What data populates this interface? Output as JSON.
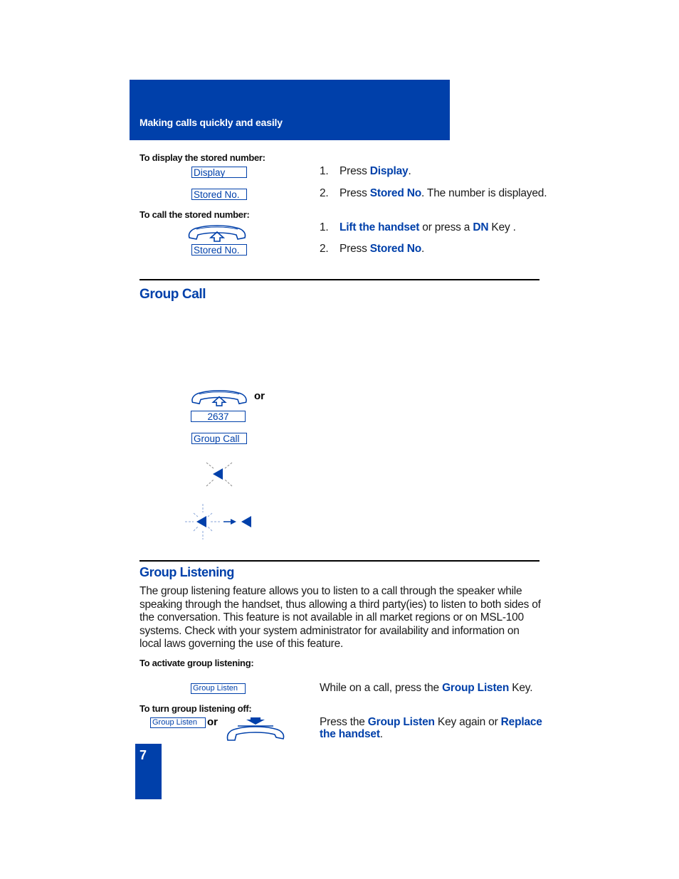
{
  "header": {
    "title": "Making calls quickly and easily",
    "color": "#0040aa"
  },
  "display_stored": {
    "subheading": "To display the stored number:",
    "keys": [
      "Display",
      "Stored No."
    ],
    "steps": [
      {
        "num": "1.",
        "pre": "Press ",
        "key": "Display",
        "post": "."
      },
      {
        "num": "2.",
        "pre": "Press ",
        "key": "Stored No",
        "post": ". The number is displayed."
      }
    ]
  },
  "call_stored": {
    "subheading": "To call the stored number:",
    "icon": "handset-lift-icon",
    "key": "Stored No.",
    "steps": [
      {
        "num": "1.",
        "key1": "Lift the handset",
        "mid": " or press a ",
        "key2": "DN",
        "post": " Key ."
      },
      {
        "num": "2.",
        "pre": "Press ",
        "key": "Stored No",
        "post": "."
      }
    ]
  },
  "group_call": {
    "title": "Group Call",
    "icon": "handset-lift-icon",
    "or_label": "or",
    "code": "2637",
    "key": "Group Call",
    "indicator_icons": [
      "indicator-flash-icon",
      "indicator-flash-to-steady-icon"
    ]
  },
  "group_listening": {
    "title": "Group Listening",
    "description": "The group listening feature allows you to listen to a call through the speaker while speaking through the handset, thus allowing a third party(ies) to listen to both sides of the conversation. This feature is not available in all market regions or on MSL-100 systems. Check with your system administrator for availability and information on local laws governing the use of this feature.",
    "activate": {
      "subheading": "To activate group listening:",
      "key": "Group Listen",
      "pre": "While on a call, press the ",
      "key_text": "Group Listen",
      "post": " Key."
    },
    "deactivate": {
      "subheading": "To turn group listening off:",
      "key": "Group Listen",
      "or_label": "or",
      "icon": "handset-replace-icon",
      "pre": "Press the ",
      "key_text": "Group Listen",
      "mid": " Key again or ",
      "key2_line1": "Replace",
      "key2_line2": "the handset",
      "post": "."
    }
  },
  "page": {
    "number": "7"
  }
}
